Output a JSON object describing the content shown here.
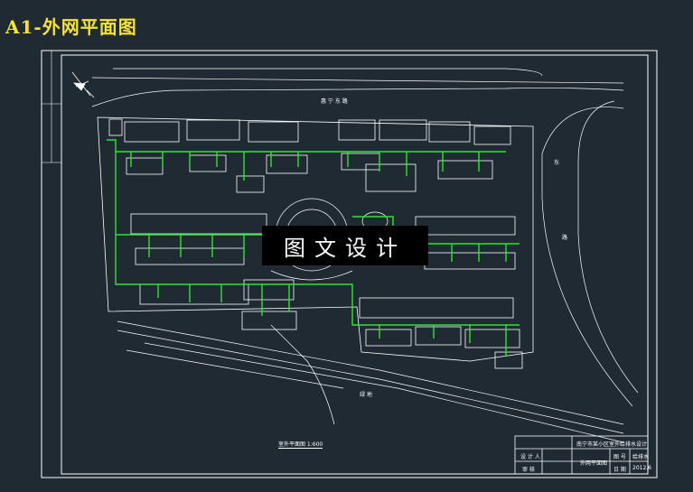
{
  "title": "A1-外网平面图",
  "watermark": "图文设计",
  "roads": {
    "north": "惠 宁 东 路",
    "east_1": "东",
    "east_2": "路",
    "south": "绿 地"
  },
  "scale_label": "室外平面图 1:600",
  "title_block": {
    "project": "南宁市某小区室外给排水设计",
    "drawing": "外网平面图",
    "designer_label": "设 计 人",
    "checker_label": "审 核",
    "drawing_no_label": "图 号",
    "drawing_no": "给排水",
    "date_label": "日 期",
    "date": "2012.6"
  },
  "colors": {
    "background": "#1f2a33",
    "pipe": "#2fe62f",
    "linework": "#ffffff",
    "title": "#f5e33b"
  }
}
